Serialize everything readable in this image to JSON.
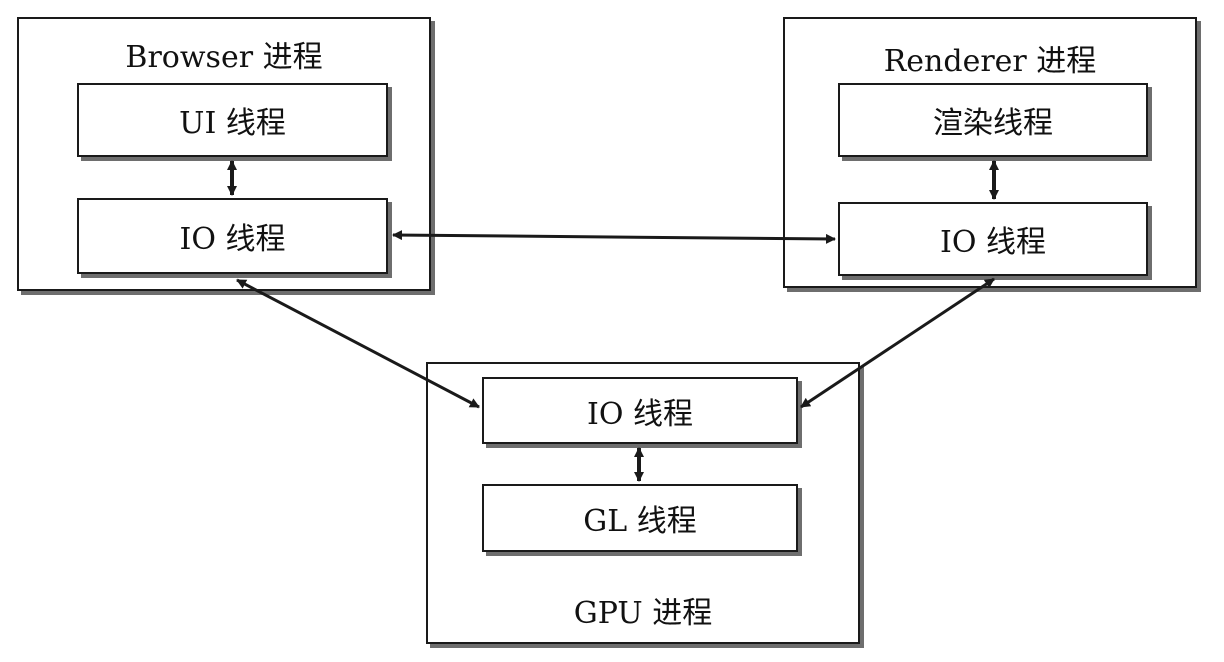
{
  "browser_process": {
    "label": "Browser 进程",
    "ui_thread": "UI 线程",
    "io_thread": "IO 线程"
  },
  "renderer_process": {
    "label": "Renderer 进程",
    "render_thread": "渲染线程",
    "io_thread": "IO 线程"
  },
  "gpu_process": {
    "label": "GPU 进程",
    "io_thread": "IO 线程",
    "gl_thread": "GL 线程"
  },
  "colors": {
    "stroke": "#1a1a1a",
    "shadow": "#6e6e6e",
    "background": "#ffffff"
  }
}
